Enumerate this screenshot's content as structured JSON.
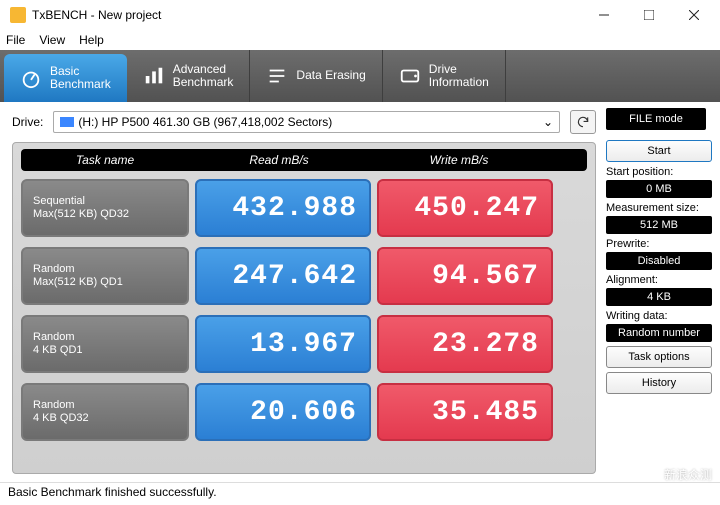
{
  "window": {
    "title": "TxBENCH - New project"
  },
  "menu": {
    "file": "File",
    "view": "View",
    "help": "Help"
  },
  "tabs": {
    "basic": "Basic\nBenchmark",
    "advanced": "Advanced\nBenchmark",
    "erase": "Data Erasing",
    "info": "Drive\nInformation"
  },
  "drive": {
    "label": "Drive:",
    "value": "(H:) HP P500   461.30 GB (967,418,002 Sectors)"
  },
  "filemode": "FILE mode",
  "grid": {
    "head_task": "Task name",
    "head_read": "Read mB/s",
    "head_write": "Write mB/s",
    "rows": [
      {
        "name1": "Sequential",
        "name2": "Max(512 KB) QD32",
        "read": "432.988",
        "write": "450.247"
      },
      {
        "name1": "Random",
        "name2": "Max(512 KB) QD1",
        "read": "247.642",
        "write": "94.567"
      },
      {
        "name1": "Random",
        "name2": "4 KB QD1",
        "read": "13.967",
        "write": "23.278"
      },
      {
        "name1": "Random",
        "name2": "4 KB QD32",
        "read": "20.606",
        "write": "35.485"
      }
    ]
  },
  "side": {
    "start": "Start",
    "startpos_lbl": "Start position:",
    "startpos_val": "0 MB",
    "meas_lbl": "Measurement size:",
    "meas_val": "512 MB",
    "prewrite_lbl": "Prewrite:",
    "prewrite_val": "Disabled",
    "align_lbl": "Alignment:",
    "align_val": "4 KB",
    "writedata_lbl": "Writing data:",
    "writedata_val": "Random number",
    "taskopts": "Task options",
    "history": "History"
  },
  "status": "Basic Benchmark finished successfully.",
  "watermark": "新浪众测",
  "chart_data": {
    "type": "table",
    "title": "TxBENCH Basic Benchmark",
    "columns": [
      "Task name",
      "Read mB/s",
      "Write mB/s"
    ],
    "rows": [
      [
        "Sequential Max(512 KB) QD32",
        432.988,
        450.247
      ],
      [
        "Random Max(512 KB) QD1",
        247.642,
        94.567
      ],
      [
        "Random 4 KB QD1",
        13.967,
        23.278
      ],
      [
        "Random 4 KB QD32",
        20.606,
        35.485
      ]
    ]
  }
}
